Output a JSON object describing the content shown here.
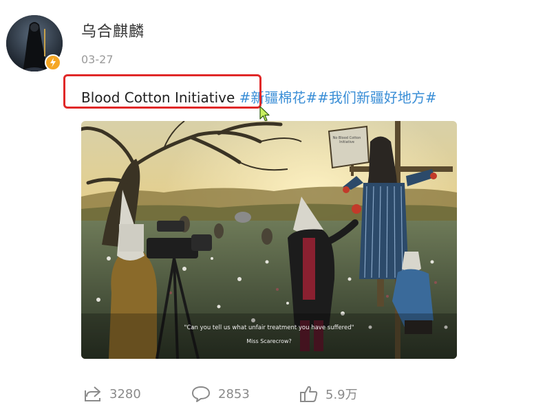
{
  "post": {
    "username": "乌合麒麟",
    "date": "03-27",
    "text_plain": "Blood Cotton Initiative ",
    "hashtags": "#新疆棉花##我们新疆好地方#",
    "image": {
      "caption_line1": "\"Can you tell us what unfair treatment you have suffered\"",
      "caption_line2": "Miss Scarecrow?",
      "sign_text": "No Blood Cotton Initiative"
    }
  },
  "actions": {
    "repost": {
      "icon": "share-icon",
      "count": "3280"
    },
    "comment": {
      "icon": "comment-icon",
      "count": "2853"
    },
    "like": {
      "icon": "thumbs-up-icon",
      "count": "5.9万"
    }
  },
  "colors": {
    "hashtag": "#3a8ed6",
    "highlight": "#e02828",
    "verified_badge": "#f5a623",
    "secondary_text": "#9a9a9a"
  }
}
